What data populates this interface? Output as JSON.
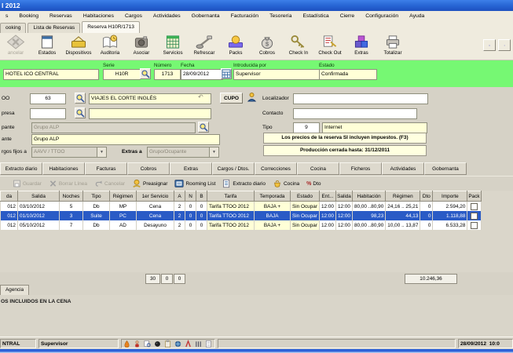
{
  "window": {
    "title": "l 2012"
  },
  "menu": {
    "items": [
      "s",
      "Booking",
      "Reservas",
      "Habitaciones",
      "Cargos",
      "Actividades",
      "Gobernanta",
      "Facturación",
      "Tesorería",
      "Estadística",
      "Cierre",
      "Configuración",
      "Ayuda"
    ]
  },
  "doc_tabs": [
    {
      "label": "ooking",
      "active": false
    },
    {
      "label": "Lista de Reservas",
      "active": false
    },
    {
      "label": "Reserva H10R/1713",
      "active": true
    }
  ],
  "toolbar": {
    "buttons": [
      {
        "label": "ancelar",
        "icon": "cancel-icon",
        "disabled": true
      },
      {
        "label": "Estados",
        "icon": "window-icon",
        "disabled": false
      },
      {
        "label": "Dispositivos",
        "icon": "device-icon",
        "disabled": false
      },
      {
        "label": "Auditoria",
        "icon": "book-clock-icon",
        "disabled": false
      },
      {
        "label": "Asociar",
        "icon": "camera-icon",
        "disabled": false
      },
      {
        "label": "Servicios",
        "icon": "calendar-grid-icon",
        "disabled": false
      },
      {
        "label": "Refrescar",
        "icon": "lever-icon",
        "disabled": false
      },
      {
        "label": "Packs",
        "icon": "pack-icon",
        "disabled": false
      },
      {
        "label": "Cobros",
        "icon": "money-bag-icon",
        "disabled": false
      },
      {
        "label": "Check In",
        "icon": "key-in-icon",
        "disabled": false
      },
      {
        "label": "Check Out",
        "icon": "page-key-icon",
        "disabled": false
      },
      {
        "label": "Extras",
        "icon": "cubes-icon",
        "disabled": false
      },
      {
        "label": "Totalizar",
        "icon": "printer-icon",
        "disabled": false
      }
    ],
    "nav": [
      {
        "icon": "nav-first-icon"
      },
      {
        "icon": "nav-prev-icon"
      }
    ]
  },
  "header": {
    "hotel": "HOTEL ICO CENTRAL",
    "serie_label": "Serie",
    "serie": "H10R",
    "serie_search_icon": "magnifier-icon",
    "numero_label": "Número",
    "numero": "1713",
    "fecha_label": "Fecha",
    "fecha": "28/09/2012",
    "fecha_icon": "calendar-icon",
    "introducida_label": "Introducida por",
    "introducida": "Supervisor",
    "estado_label": "Estado",
    "estado": "Confirmada"
  },
  "form": {
    "ttoo_label": "OO",
    "ttoo_code": "63",
    "ttoo_name": "VIAJES EL CORTE INGLÉS",
    "ttoo_undo_icon": "undo-arrow-icon",
    "cupo_label": "CUPO",
    "cupo_person_icon": "person-icon",
    "empresa_label": "presa",
    "empresa_code": "",
    "empresa_name": "",
    "titular_label": "pante",
    "titular": "Grupo ALP",
    "ocupante_label": "ante",
    "ocupante": "Grupo ALP",
    "cargos_label": "rgos fijos a",
    "cargos_value": "AAVV / TTOO",
    "extras_label": "Extras a",
    "extras_value": "Grupo/Ocupante",
    "localizador_label": "Localizador",
    "localizador": "",
    "contacto_label": "Contacto",
    "contacto": "",
    "tipo_label": "Tipo",
    "tipo_code": "9",
    "tipo_name": "Internet",
    "search_icon": "magnifier-icon",
    "msg1": "Los precios de la reserva SI incluyen impuestos. (F3)",
    "msg2": "Producción cerrada hasta: 31/12/2011"
  },
  "section_tabs": [
    "Extracto diario",
    "Habitaciones",
    "Facturas",
    "Cobros",
    "Extras",
    "Cargos / Dtos.",
    "Correcciones",
    "Cocina",
    "Ficheros",
    "Actividades",
    "Gobernanta"
  ],
  "grid_toolbar": {
    "items": [
      {
        "label": "Guardar",
        "icon": "save-icon",
        "disabled": true
      },
      {
        "label": "Borrar Línea",
        "icon": "x-icon",
        "disabled": true
      },
      {
        "label": "Cancelar",
        "icon": "undo-arrow-icon",
        "disabled": true
      },
      {
        "label": "Preasignar",
        "icon": "hand-coin-icon",
        "disabled": false
      },
      {
        "label": "Rooming List",
        "icon": "room-list-icon",
        "disabled": false
      },
      {
        "label": "Extracto diario",
        "icon": "page-lines-icon",
        "disabled": false
      },
      {
        "label": "Cocina",
        "icon": "cup-icon",
        "disabled": false
      },
      {
        "label": "Dto",
        "icon": "percent-icon",
        "disabled": false
      }
    ]
  },
  "grid": {
    "columns": [
      "da",
      "Salida",
      "Noches",
      "Tipo",
      "Régimen",
      "1er Servicio",
      "A",
      "N",
      "B",
      "Tarifa",
      "Temporada",
      "Estado",
      "Ent...",
      "Salida",
      "Habitación",
      "Régimen",
      "Dto",
      "Importe",
      "Pack"
    ],
    "rows": [
      [
        "012",
        "03/10/2012",
        "5",
        "Db",
        "MP",
        "Cena",
        "2",
        "0",
        "0",
        "Tarifa TTOO 2012",
        "BAJA +",
        "Sin Ocupar",
        "12:00",
        "12:00",
        "80,00 ..80,90",
        "24,16 .. 25,21",
        "0",
        "2.594,20"
      ],
      [
        "012",
        "01/10/2012",
        "3",
        "Suite",
        "PC",
        "Cena",
        "2",
        "0",
        "0",
        "Tarifa TTOO 2012",
        "BAJA",
        "Sin Ocupar",
        "12:00",
        "12:00",
        "98,23",
        "44,13",
        "0",
        "1.118,88"
      ],
      [
        "012",
        "05/10/2012",
        "7",
        "Db",
        "AD",
        "Desayuno",
        "2",
        "0",
        "0",
        "Tarifa TTOO 2012",
        "BAJA +",
        "Sin Ocupar",
        "12:00",
        "12:00",
        "80,00 ..80,90",
        "10,00 .. 13,87",
        "0",
        "6.533,28"
      ]
    ],
    "selected_row": 1,
    "summary": {
      "a": "30",
      "n": "0",
      "b": "0",
      "total": "10.246,36"
    }
  },
  "notes": {
    "tab": "Agencia",
    "text": "OS INCLUIDOS EN LA CENA"
  },
  "statusbar": {
    "left": "NTRAL",
    "user": "Supervisor",
    "icons": [
      "flame-icon",
      "person-icon",
      "search-doc-icon",
      "ball-icon",
      "clipboard-icon",
      "globe-icon",
      "marker-icon",
      "bars-icon",
      "doc-icon"
    ],
    "date": "28/09/2012",
    "time": "10:0"
  },
  "colors": {
    "highlight": "#2A5BC6",
    "green_band": "#76F873",
    "field_yellow": "#FFFFD7",
    "titlebar_blue": "#2663D2"
  }
}
